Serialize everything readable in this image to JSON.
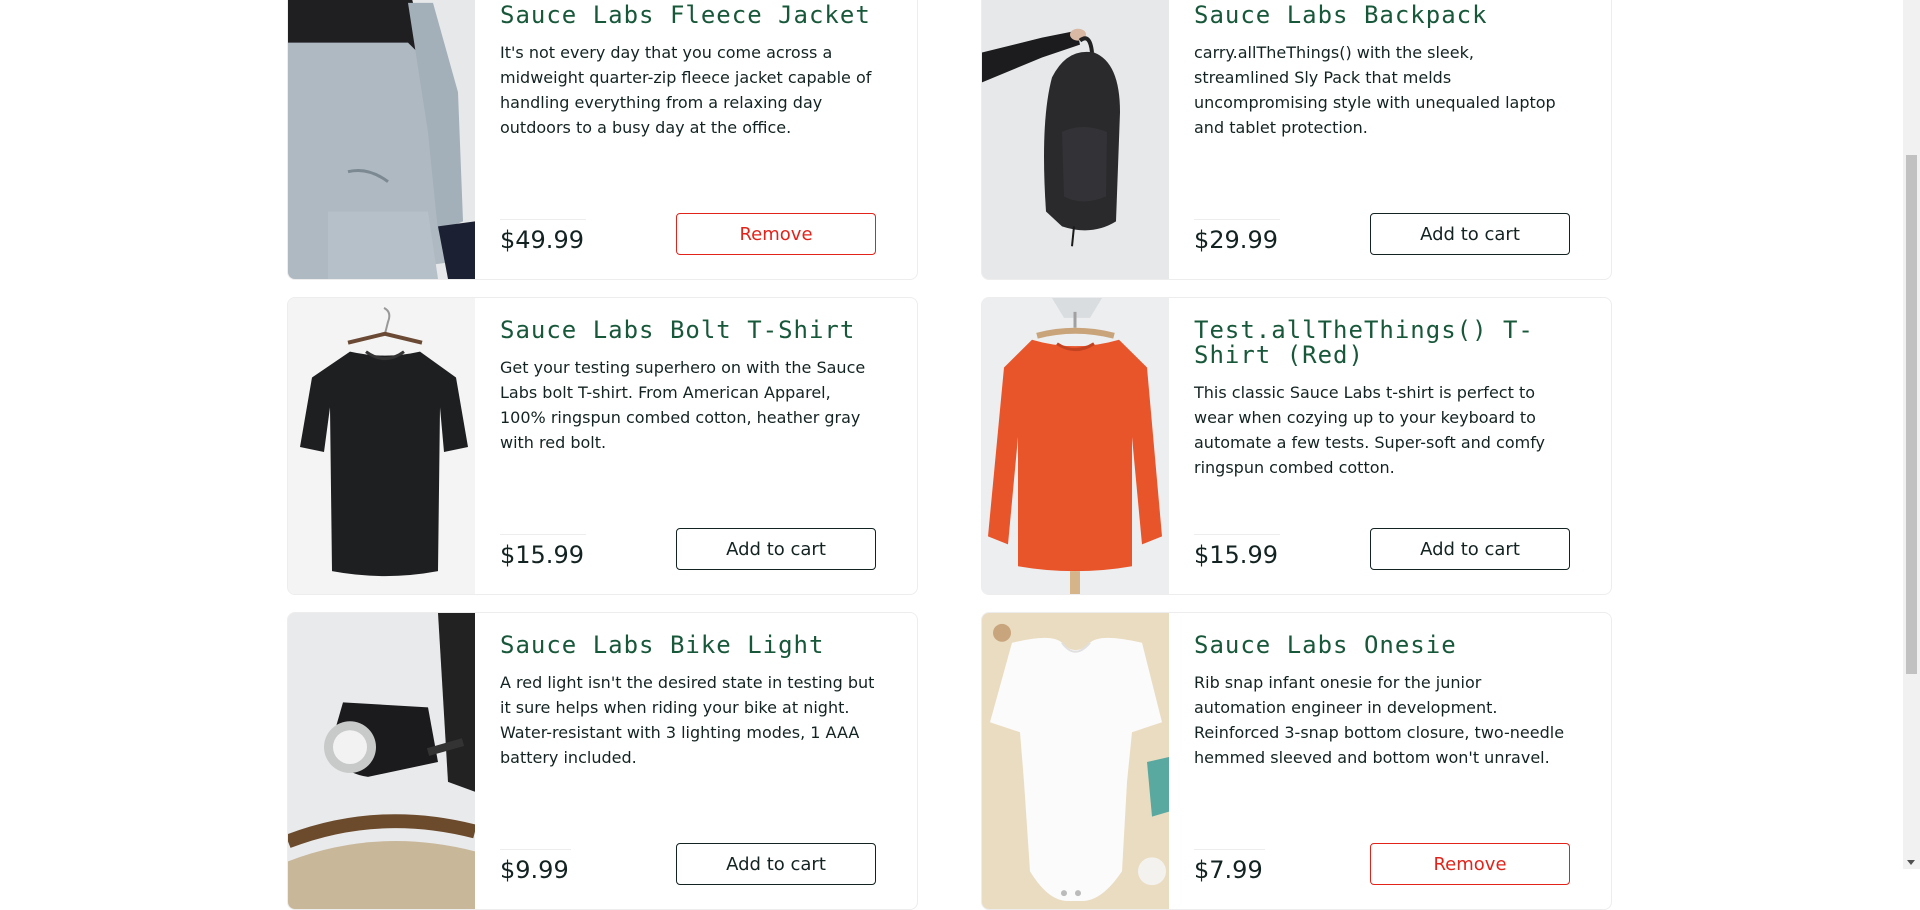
{
  "inventory": {
    "items": [
      {
        "name": "Sauce Labs Fleece Jacket",
        "description": "It's not every day that you come across a midweight quarter-zip fleece jacket capable of handling everything from a relaxing day outdoors to a busy day at the office.",
        "price": "$49.99",
        "button": "Remove",
        "button_type": "remove",
        "image": "fleece-jacket"
      },
      {
        "name": "Sauce Labs Backpack",
        "description": "carry.allTheThings() with the sleek, streamlined Sly Pack that melds uncompromising style with unequaled laptop and tablet protection.",
        "price": "$29.99",
        "button": "Add to cart",
        "button_type": "add",
        "image": "backpack"
      },
      {
        "name": "Sauce Labs Bolt T-Shirt",
        "description": "Get your testing superhero on with the Sauce Labs bolt T-shirt. From American Apparel, 100% ringspun combed cotton, heather gray with red bolt.",
        "price": "$15.99",
        "button": "Add to cart",
        "button_type": "add",
        "image": "bolt-tshirt"
      },
      {
        "name": "Test.allTheThings() T-Shirt (Red)",
        "description": "This classic Sauce Labs t-shirt is perfect to wear when cozying up to your keyboard to automate a few tests. Super-soft and comfy ringspun combed cotton.",
        "price": "$15.99",
        "button": "Add to cart",
        "button_type": "add",
        "image": "red-shirt"
      },
      {
        "name": "Sauce Labs Bike Light",
        "description": "A red light isn't the desired state in testing but it sure helps when riding your bike at night. Water-resistant with 3 lighting modes, 1 AAA battery included.",
        "price": "$9.99",
        "button": "Add to cart",
        "button_type": "add",
        "image": "bike-light"
      },
      {
        "name": "Sauce Labs Onesie",
        "description": "Rib snap infant onesie for the junior automation engineer in development. Reinforced 3-snap bottom closure, two-needle hemmed sleeved and bottom won't unravel.",
        "price": "$7.99",
        "button": "Remove",
        "button_type": "remove",
        "image": "onesie"
      }
    ]
  },
  "colors": {
    "item_name": "#18583a",
    "remove": "#e2231a",
    "text": "#132322"
  }
}
